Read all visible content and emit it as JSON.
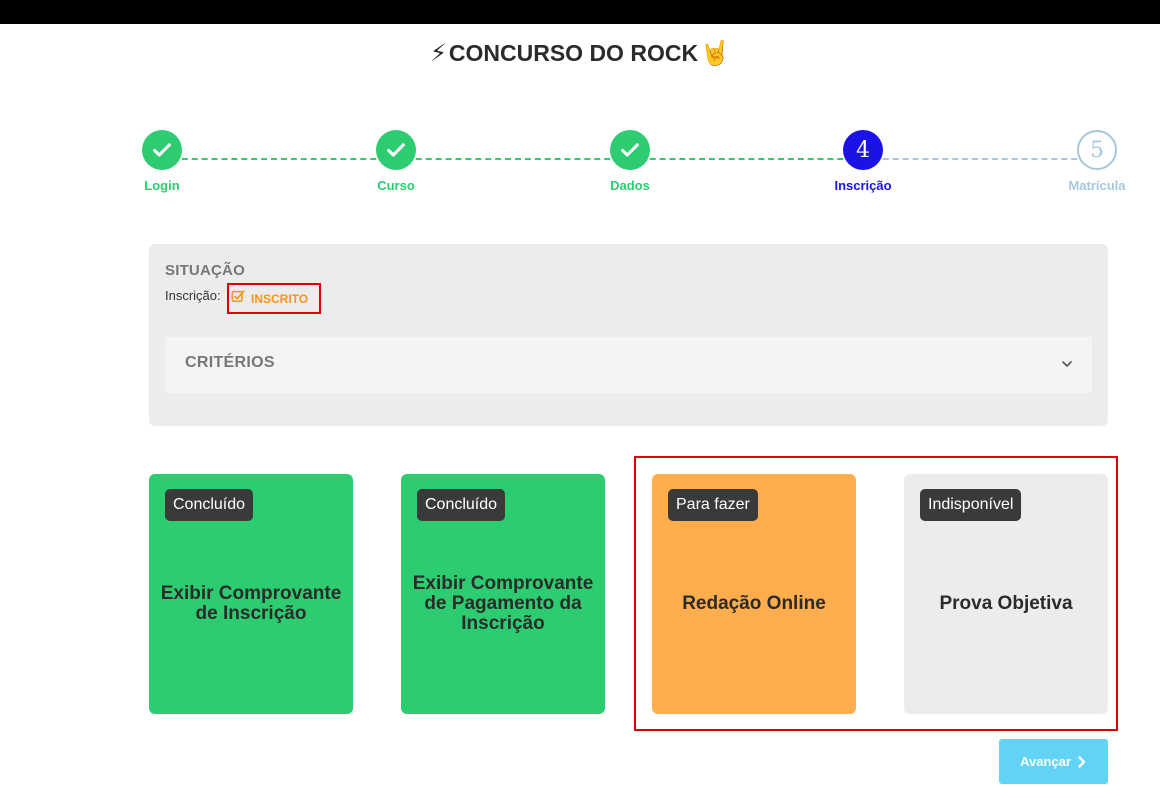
{
  "header": {
    "title": "CONCURSO DO ROCK",
    "emoji_left": "⚡",
    "emoji_right": "🤘"
  },
  "stepper": {
    "steps": [
      {
        "label": "Login",
        "state": "done",
        "number": "1"
      },
      {
        "label": "Curso",
        "state": "done",
        "number": "2"
      },
      {
        "label": "Dados",
        "state": "done",
        "number": "3"
      },
      {
        "label": "Inscrição",
        "state": "current",
        "number": "4"
      },
      {
        "label": "Matrícula",
        "state": "pending",
        "number": "5"
      }
    ]
  },
  "situation": {
    "heading": "SITUAÇÃO",
    "inscription_label": "Inscrição:",
    "status": "INSCRITO",
    "status_icon": "check-square-icon",
    "criteria_title": "CRITÉRIOS"
  },
  "cards": [
    {
      "badge": "Concluído",
      "title": "Exibir Comprovante de Inscrição",
      "variant": "green"
    },
    {
      "badge": "Concluído",
      "title": "Exibir Comprovante de Pagamento da Inscrição",
      "variant": "green"
    },
    {
      "badge": "Para fazer",
      "title": "Redação Online",
      "variant": "orange"
    },
    {
      "badge": "Indisponível",
      "title": "Prova Objetiva",
      "variant": "gray"
    }
  ],
  "actions": {
    "next_label": "Avançar"
  },
  "colors": {
    "done": "#2ecc71",
    "current": "#1a12e6",
    "pending": "#a7c8da",
    "status": "#f7941d",
    "highlight": "#e0000a",
    "next_button": "#62d3f4"
  }
}
